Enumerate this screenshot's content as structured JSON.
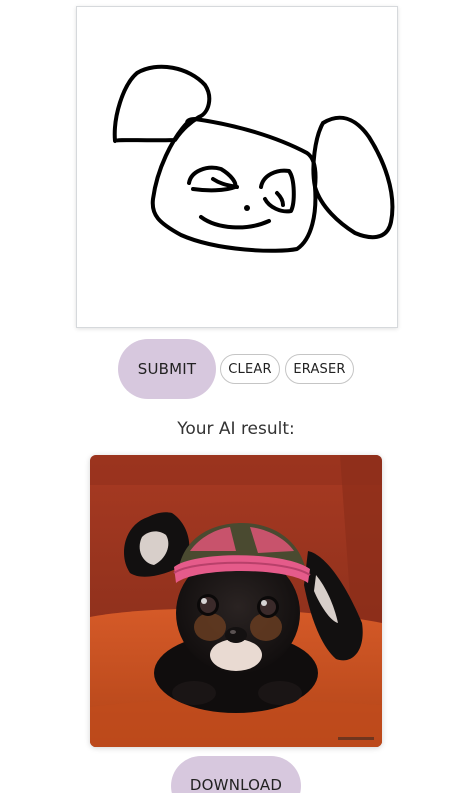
{
  "drawing_canvas": {
    "stroke_color": "#000000",
    "background_color": "#ffffff"
  },
  "controls": {
    "submit_label": "SUBMIT",
    "clear_label": "CLEAR",
    "eraser_label": "ERASER"
  },
  "result": {
    "heading": "Your AI result:",
    "download_label": "DOWNLOAD"
  },
  "colors": {
    "primary_button_bg": "#d7c8de",
    "secondary_button_border": "#c5c5c5"
  }
}
